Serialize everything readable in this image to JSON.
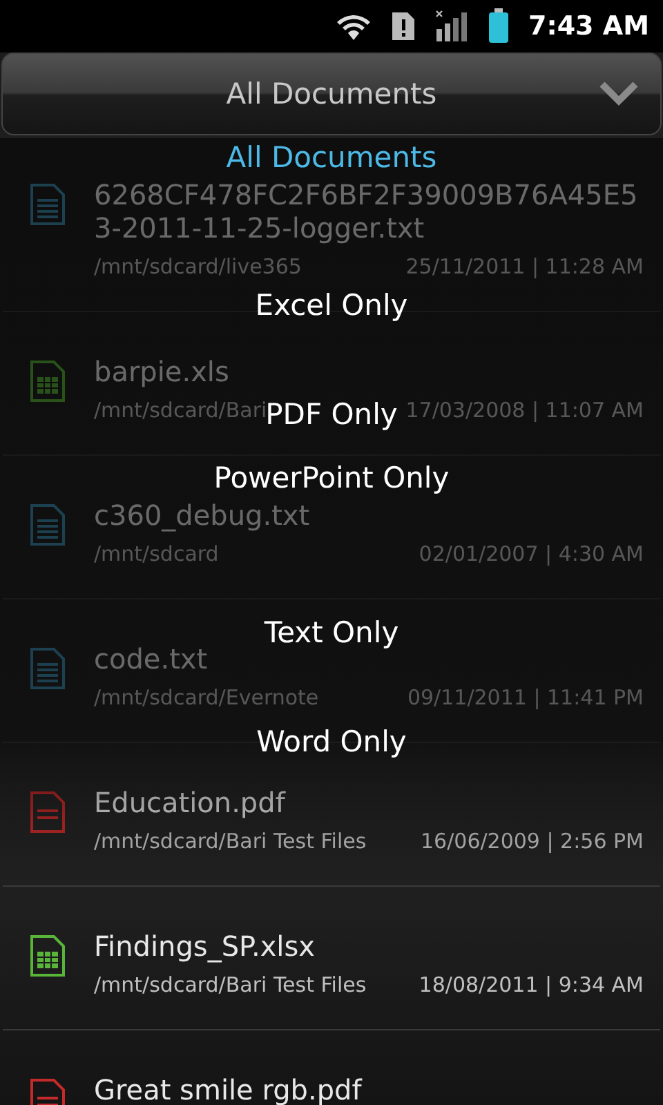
{
  "status_bar": {
    "time": "7:43 AM"
  },
  "header": {
    "title": "All Documents"
  },
  "files": [
    {
      "kind": "text",
      "name": "6268CF478FC2F6BF2F39009B76A45E53-2011-11-25-logger.txt",
      "path": "/mnt/sdcard/live365",
      "date": "25/11/2011 | 11:28 AM"
    },
    {
      "kind": "sheet",
      "name": "barpie.xls",
      "path": "/mnt/sdcard/Bari",
      "date": "17/03/2008 | 11:07 AM"
    },
    {
      "kind": "text",
      "name": "c360_debug.txt",
      "path": "/mnt/sdcard",
      "date": "02/01/2007 | 4:30 AM"
    },
    {
      "kind": "text",
      "name": "code.txt",
      "path": "/mnt/sdcard/Evernote",
      "date": "09/11/2011 | 11:41 PM"
    },
    {
      "kind": "pdf",
      "name": "Education.pdf",
      "path": "/mnt/sdcard/Bari Test Files",
      "date": "16/06/2009 | 2:56 PM"
    },
    {
      "kind": "sheet",
      "name": "Findings_SP.xlsx",
      "path": "/mnt/sdcard/Bari Test Files",
      "date": "18/08/2011 | 9:34 AM"
    },
    {
      "kind": "pdf",
      "name": "Great smile rgb.pdf"
    }
  ],
  "menu": {
    "options": [
      {
        "label": "All Documents",
        "selected": true
      },
      {
        "label": "Excel Only",
        "selected": false
      },
      {
        "label": "PDF Only",
        "selected": false
      },
      {
        "label": "PowerPoint Only",
        "selected": false
      },
      {
        "label": "Text Only",
        "selected": false
      },
      {
        "label": "Word Only",
        "selected": false
      }
    ]
  }
}
